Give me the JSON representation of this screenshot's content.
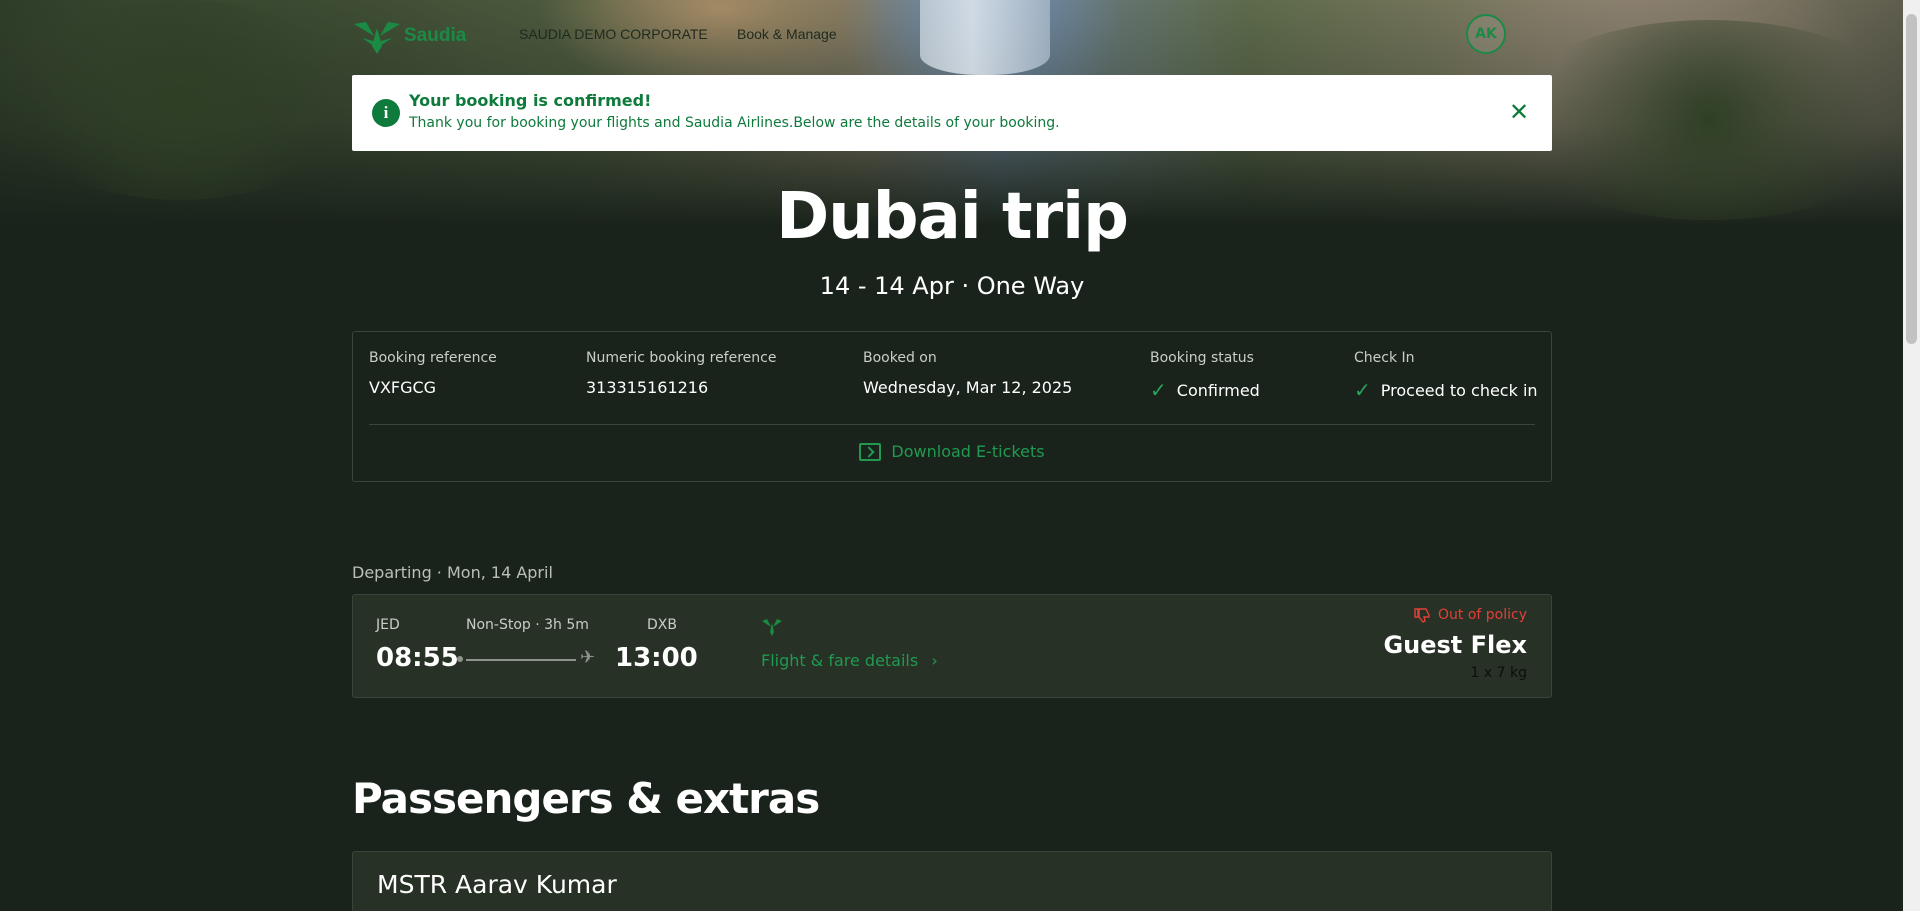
{
  "header": {
    "logo_text": "Saudia",
    "company": "SAUDIA DEMO CORPORATE",
    "nav_book_manage": "Book & Manage",
    "avatar_initials": "AK"
  },
  "alert": {
    "title": "Your booking is confirmed!",
    "message": "Thank you for booking your flights and Saudia Airlines.Below are the details of your booking.",
    "close_icon": "close-icon"
  },
  "trip": {
    "title": "Dubai trip",
    "subtitle": "14 - 14 Apr · One Way"
  },
  "booking": {
    "reference_label": "Booking reference",
    "reference_value": "VXFGCG",
    "numeric_label": "Numeric booking reference",
    "numeric_value": "313315161216",
    "booked_on_label": "Booked on",
    "booked_on_value": "Wednesday, Mar 12, 2025",
    "status_label": "Booking status",
    "status_value": "Confirmed",
    "checkin_label": "Check In",
    "checkin_value": "Proceed to check in",
    "download_label": "Download E-tickets"
  },
  "departing": {
    "label": "Departing · Mon, 14 April",
    "origin": "JED",
    "destination": "DXB",
    "route_info": "Non-Stop · 3h 5m",
    "depart_time": "08:55",
    "arrive_time": "13:00",
    "fare_link": "Flight & fare details",
    "policy": "Out of policy",
    "fare_name": "Guest Flex",
    "baggage": "1 x 7 kg"
  },
  "passengers": {
    "title": "Passengers & extras",
    "first_name": "MSTR Aarav Kumar"
  },
  "colors": {
    "brand_green": "#1b8a45",
    "background": "#1a231b",
    "policy_red": "#e0403a"
  }
}
